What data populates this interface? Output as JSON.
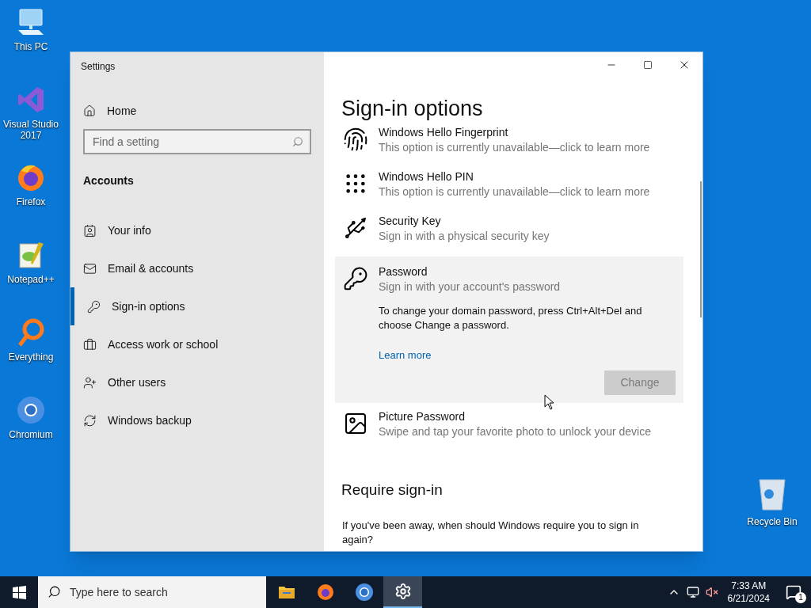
{
  "desktop_icons": [
    {
      "label": "This PC"
    },
    {
      "label": "Visual Studio 2017"
    },
    {
      "label": "Firefox"
    },
    {
      "label": "Notepad++"
    },
    {
      "label": "Everything"
    },
    {
      "label": "Chromium"
    }
  ],
  "recycle_bin": {
    "label": "Recycle Bin"
  },
  "window": {
    "title": "Settings",
    "sidebar": {
      "home": "Home",
      "search": {
        "placeholder": "Find a setting"
      },
      "section": "Accounts",
      "items": [
        {
          "label": "Your info",
          "selected": false
        },
        {
          "label": "Email & accounts",
          "selected": false
        },
        {
          "label": "Sign-in options",
          "selected": true
        },
        {
          "label": "Access work or school",
          "selected": false
        },
        {
          "label": "Other users",
          "selected": false
        },
        {
          "label": "Windows backup",
          "selected": false
        }
      ]
    },
    "content": {
      "title": "Sign-in options",
      "options": [
        {
          "title": "Windows Hello Fingerprint",
          "description": "This option is currently unavailable—click to learn more",
          "expanded": false
        },
        {
          "title": "Windows Hello PIN",
          "description": "This option is currently unavailable—click to learn more",
          "expanded": false
        },
        {
          "title": "Security Key",
          "description": "Sign in with a physical security key",
          "expanded": false
        },
        {
          "title": "Password",
          "description": "Sign in with your account's password",
          "expanded": true,
          "body": "To change your domain password, press Ctrl+Alt+Del and choose Change a password.",
          "link": "Learn more",
          "button": {
            "label": "Change",
            "disabled": true
          }
        },
        {
          "title": "Picture Password",
          "description": "Swipe and tap your favorite photo to unlock your device",
          "expanded": false
        }
      ],
      "section": "Require sign-in",
      "question": "If you've been away, when should Windows require you to sign in again?"
    }
  },
  "taskbar": {
    "search": {
      "placeholder": "Type here to search"
    },
    "apps": [
      {
        "selected": false
      },
      {
        "selected": false
      },
      {
        "selected": false
      },
      {
        "selected": true
      }
    ],
    "time": "7:33 AM",
    "date": "6/21/2024",
    "notifications": "1"
  }
}
